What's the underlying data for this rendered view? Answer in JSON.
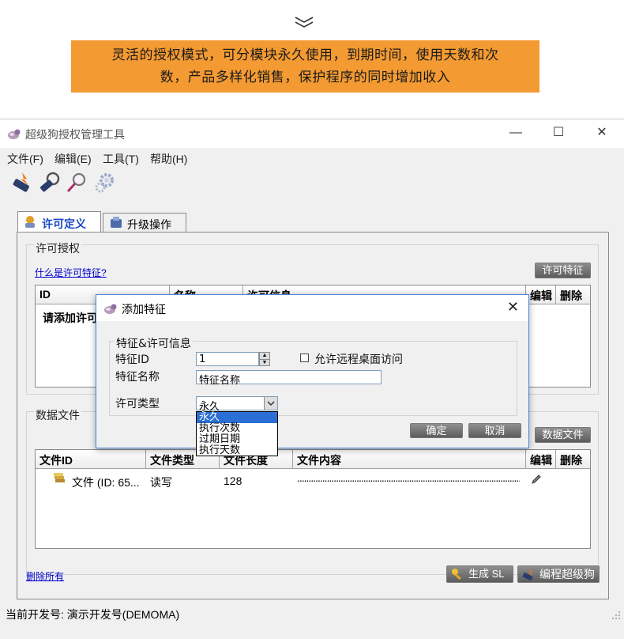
{
  "banner": {
    "line1": "灵活的授权模式，可分模块永久使用，到期时间，使用天数和次",
    "line2": "数，产品多样化销售，保护程序的同时增加收入"
  },
  "window": {
    "title": "超级狗授权管理工具",
    "menu": [
      "文件(F)",
      "编辑(E)",
      "工具(T)",
      "帮助(H)"
    ]
  },
  "tabs": [
    {
      "label": "许可定义",
      "active": true
    },
    {
      "label": "升级操作",
      "active": false
    }
  ],
  "license_section": {
    "title": "许可授权",
    "link": "什么是许可特征?",
    "button": "许可特征",
    "columns": [
      "ID",
      "名称",
      "许可信息",
      "编辑",
      "删除"
    ],
    "empty_text": "请添加许可"
  },
  "data_section": {
    "title": "数据文件",
    "button": "数据文件",
    "columns": [
      "文件ID",
      "文件类型",
      "文件长度",
      "文件内容",
      "编辑",
      "删除"
    ],
    "rows": [
      {
        "id": "文件 (ID: 65...",
        "type": "读写",
        "length": "128",
        "content": "................................................................................................................"
      }
    ]
  },
  "footer": {
    "delete_all": "删除所有",
    "generate": "生成 SL",
    "program": "编程超级狗"
  },
  "status": "当前开发号: 演示开发号(DEMOMA)",
  "dialog": {
    "title": "添加特征",
    "group_title": "特征&许可信息",
    "feature_id_label": "特征ID",
    "feature_id_value": "1",
    "remote_label": "允许远程桌面访问",
    "feature_name_label": "特征名称",
    "feature_name_value": "特征名称",
    "license_type_label": "许可类型",
    "license_type_value": "永久",
    "license_options": [
      "永久",
      "执行次数",
      "过期日期",
      "执行天数"
    ],
    "ok": "确定",
    "cancel": "取消"
  },
  "colors": {
    "banner": "#f49a32",
    "link": "#0000d0",
    "active_tab": "#1846c4",
    "selection": "#2a6fd6"
  }
}
